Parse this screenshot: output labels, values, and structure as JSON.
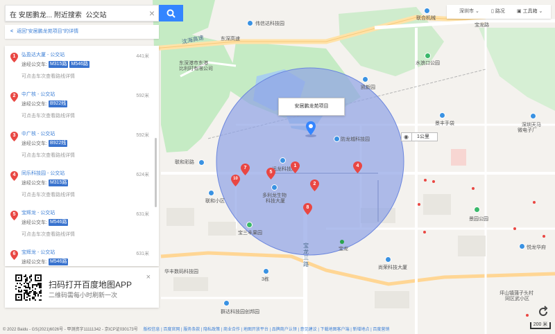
{
  "search": {
    "value": "在 安居鹏龙... 附近搜索  公交站"
  },
  "back": {
    "arrow": "<",
    "label": "返回\"安居鹏龙苑项目\"的详情"
  },
  "results": [
    {
      "index": "1",
      "title": "弘盈达大厦 - 公交站",
      "distance": "441米",
      "routes_label": "途经公交车:",
      "routes": [
        "M315路",
        "M546路"
      ],
      "hint": "可点击车次查看路线详情"
    },
    {
      "index": "2",
      "title": "中广核 - 公交站",
      "distance": "592米",
      "routes_label": "途经公交车:",
      "routes": [
        "B922线"
      ],
      "hint": "可点击车次查看路线详情"
    },
    {
      "index": "3",
      "title": "中广核 - 公交站",
      "distance": "592米",
      "routes_label": "途经公交车:",
      "routes": [
        "B922线"
      ],
      "hint": "可点击车次查看路线详情"
    },
    {
      "index": "4",
      "title": "同乐科技园 - 公交站",
      "distance": "624米",
      "routes_label": "途经公交车:",
      "routes": [
        "M315路"
      ],
      "hint": "可点击车次查看路线详情"
    },
    {
      "index": "5",
      "title": "宝辉龙 - 公交站",
      "distance": "631米",
      "routes_label": "途经公交车:",
      "routes": [
        "M546路"
      ],
      "hint": "可点击车次查看路线详情"
    },
    {
      "index": "6",
      "title": "宝辉龙 - 公交站",
      "distance": "631米",
      "routes_label": "途经公交车:",
      "routes": [
        "M546路"
      ],
      "hint": ""
    }
  ],
  "promo": {
    "title": "扫码打开百度地图APP",
    "subtitle": "二维码需每小时刷新一次",
    "close": "×"
  },
  "toolbar": {
    "city": "深圳市",
    "traffic": "路况",
    "tools": "工具箱"
  },
  "map": {
    "callout": "安居鹏龙苑项目",
    "scale_box": "1公里",
    "scale_bar": "200 米",
    "circle_fill": "#8ea3e6",
    "pin_color": "#e94743",
    "accent": "#3385ff",
    "labels": {
      "weixin": "伟信达科技园",
      "lianhe_mech": "联合机械",
      "baolong_road": "宝龙",
      "yanhai": "沈海高速",
      "dongshen": "东深高速",
      "yanhai2": "凯新园",
      "shenzhen_port": "东深港市东港",
      "shuilong": "水浪口公园",
      "bubian": "比利时有限公司",
      "fangda": "防龙城科技园",
      "jingfeng": "景丰手袋",
      "tianma": "深圳天马",
      "tianma2": "微电子厂",
      "lianhe_road": "联和彩路",
      "lianhe_village": "联和小区",
      "yuanlong": "远龙科技厂",
      "duoli": "多利龙生物",
      "duoli2": "科技大厦",
      "baosanfeng": "宝三丰果园",
      "jingyuan": "景园公园",
      "yuelong": "悦龙华府",
      "baolong3": "宝龙三路",
      "baolong_station": "宝龙",
      "shangrong": "尚荣科技大厦",
      "huafeng": "华丰数码科技园",
      "sanqi": "3栋",
      "qunda": "群达科技园创邦园",
      "pingshan": "坪山镇蒲子头村",
      "pingshan2": "同区武小区",
      "baolong_n": "宝龙路"
    }
  },
  "footer": {
    "copyright": "© 2022 Baidu - GS(2021)6026号 - 甲测资字11111342 - 京ICP证030173号",
    "links": "版权信息 | 百度官网 | 服务条款 | 隐私政策 | 商业合作 | 地图开放平台 | 品牌商户认领 | 意见建议 | 下载地图客户端 | 新增地点 | 百度营销"
  }
}
